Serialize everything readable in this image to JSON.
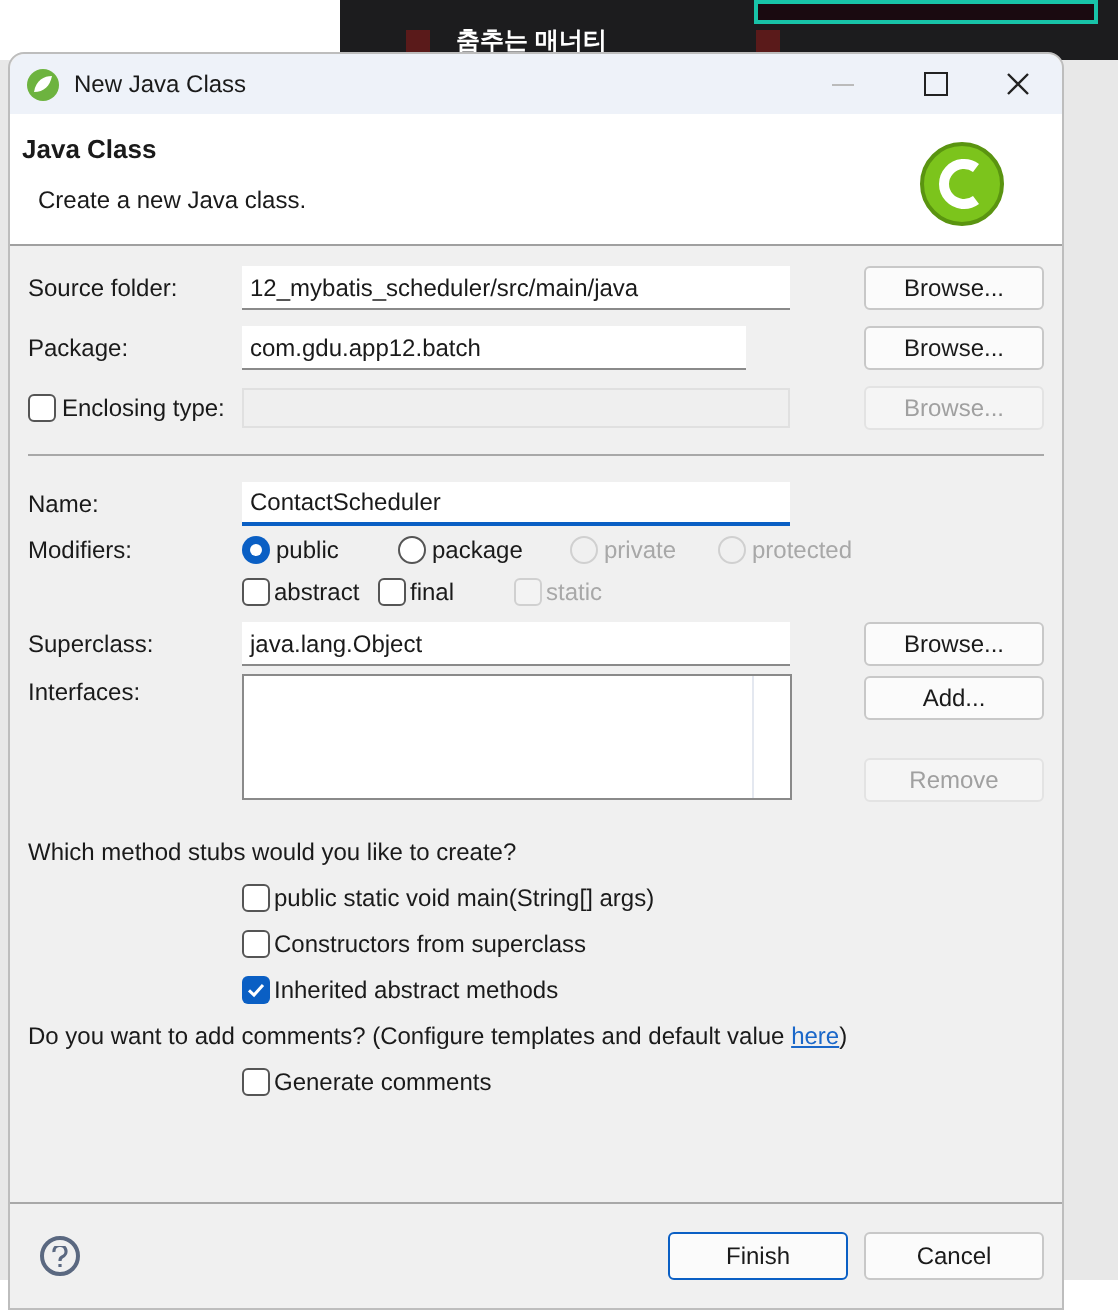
{
  "background": {
    "tile_label": "춤추는 매너티"
  },
  "window": {
    "title": "New Java Class"
  },
  "header": {
    "title": "Java Class",
    "description": "Create a new Java class."
  },
  "source_folder": {
    "label": "Source folder:",
    "value": "12_mybatis_scheduler/src/main/java",
    "button": {
      "label": "Browse...",
      "disabled": false
    }
  },
  "package": {
    "label": "Package:",
    "value": "com.gdu.app12.batch",
    "button": {
      "label": "Browse...",
      "disabled": false
    }
  },
  "enclosing_type": {
    "label": "Enclosing type:",
    "checked": false,
    "disabled": true,
    "button": {
      "label": "Browse...",
      "disabled": true
    }
  },
  "name": {
    "label": "Name:",
    "value": "ContactScheduler",
    "focused": true
  },
  "modifiers": {
    "label": "Modifiers:",
    "access": [
      {
        "label": "public",
        "selected": true,
        "disabled": false
      },
      {
        "label": "package",
        "selected": false,
        "disabled": false
      },
      {
        "label": "private",
        "selected": false,
        "disabled": true
      },
      {
        "label": "protected",
        "selected": false,
        "disabled": true
      }
    ],
    "other": [
      {
        "label": "abstract",
        "checked": false,
        "disabled": false
      },
      {
        "label": "final",
        "checked": false,
        "disabled": false
      },
      {
        "label": "static",
        "checked": false,
        "disabled": true
      }
    ]
  },
  "superclass": {
    "label": "Superclass:",
    "value": "java.lang.Object",
    "button": {
      "label": "Browse...",
      "disabled": false
    }
  },
  "interfaces": {
    "label": "Interfaces:",
    "buttons": [
      {
        "label": "Add...",
        "disabled": false
      },
      {
        "label": "Remove",
        "disabled": true
      }
    ]
  },
  "stubs": {
    "question": "Which method stubs would you like to create?",
    "options": [
      {
        "label": "public static void main(String[] args)",
        "checked": false
      },
      {
        "label": "Constructors from superclass",
        "checked": false
      },
      {
        "label": "Inherited abstract methods",
        "checked": true
      }
    ]
  },
  "comments": {
    "question": "Do you want to add comments? (Configure templates and default value ",
    "link": "here",
    "suffix": ")",
    "options": [
      {
        "label": "Generate comments",
        "checked": false
      }
    ]
  },
  "buttons": [
    {
      "label": "Finish",
      "default": true
    },
    {
      "label": "Cancel",
      "default": false
    }
  ]
}
